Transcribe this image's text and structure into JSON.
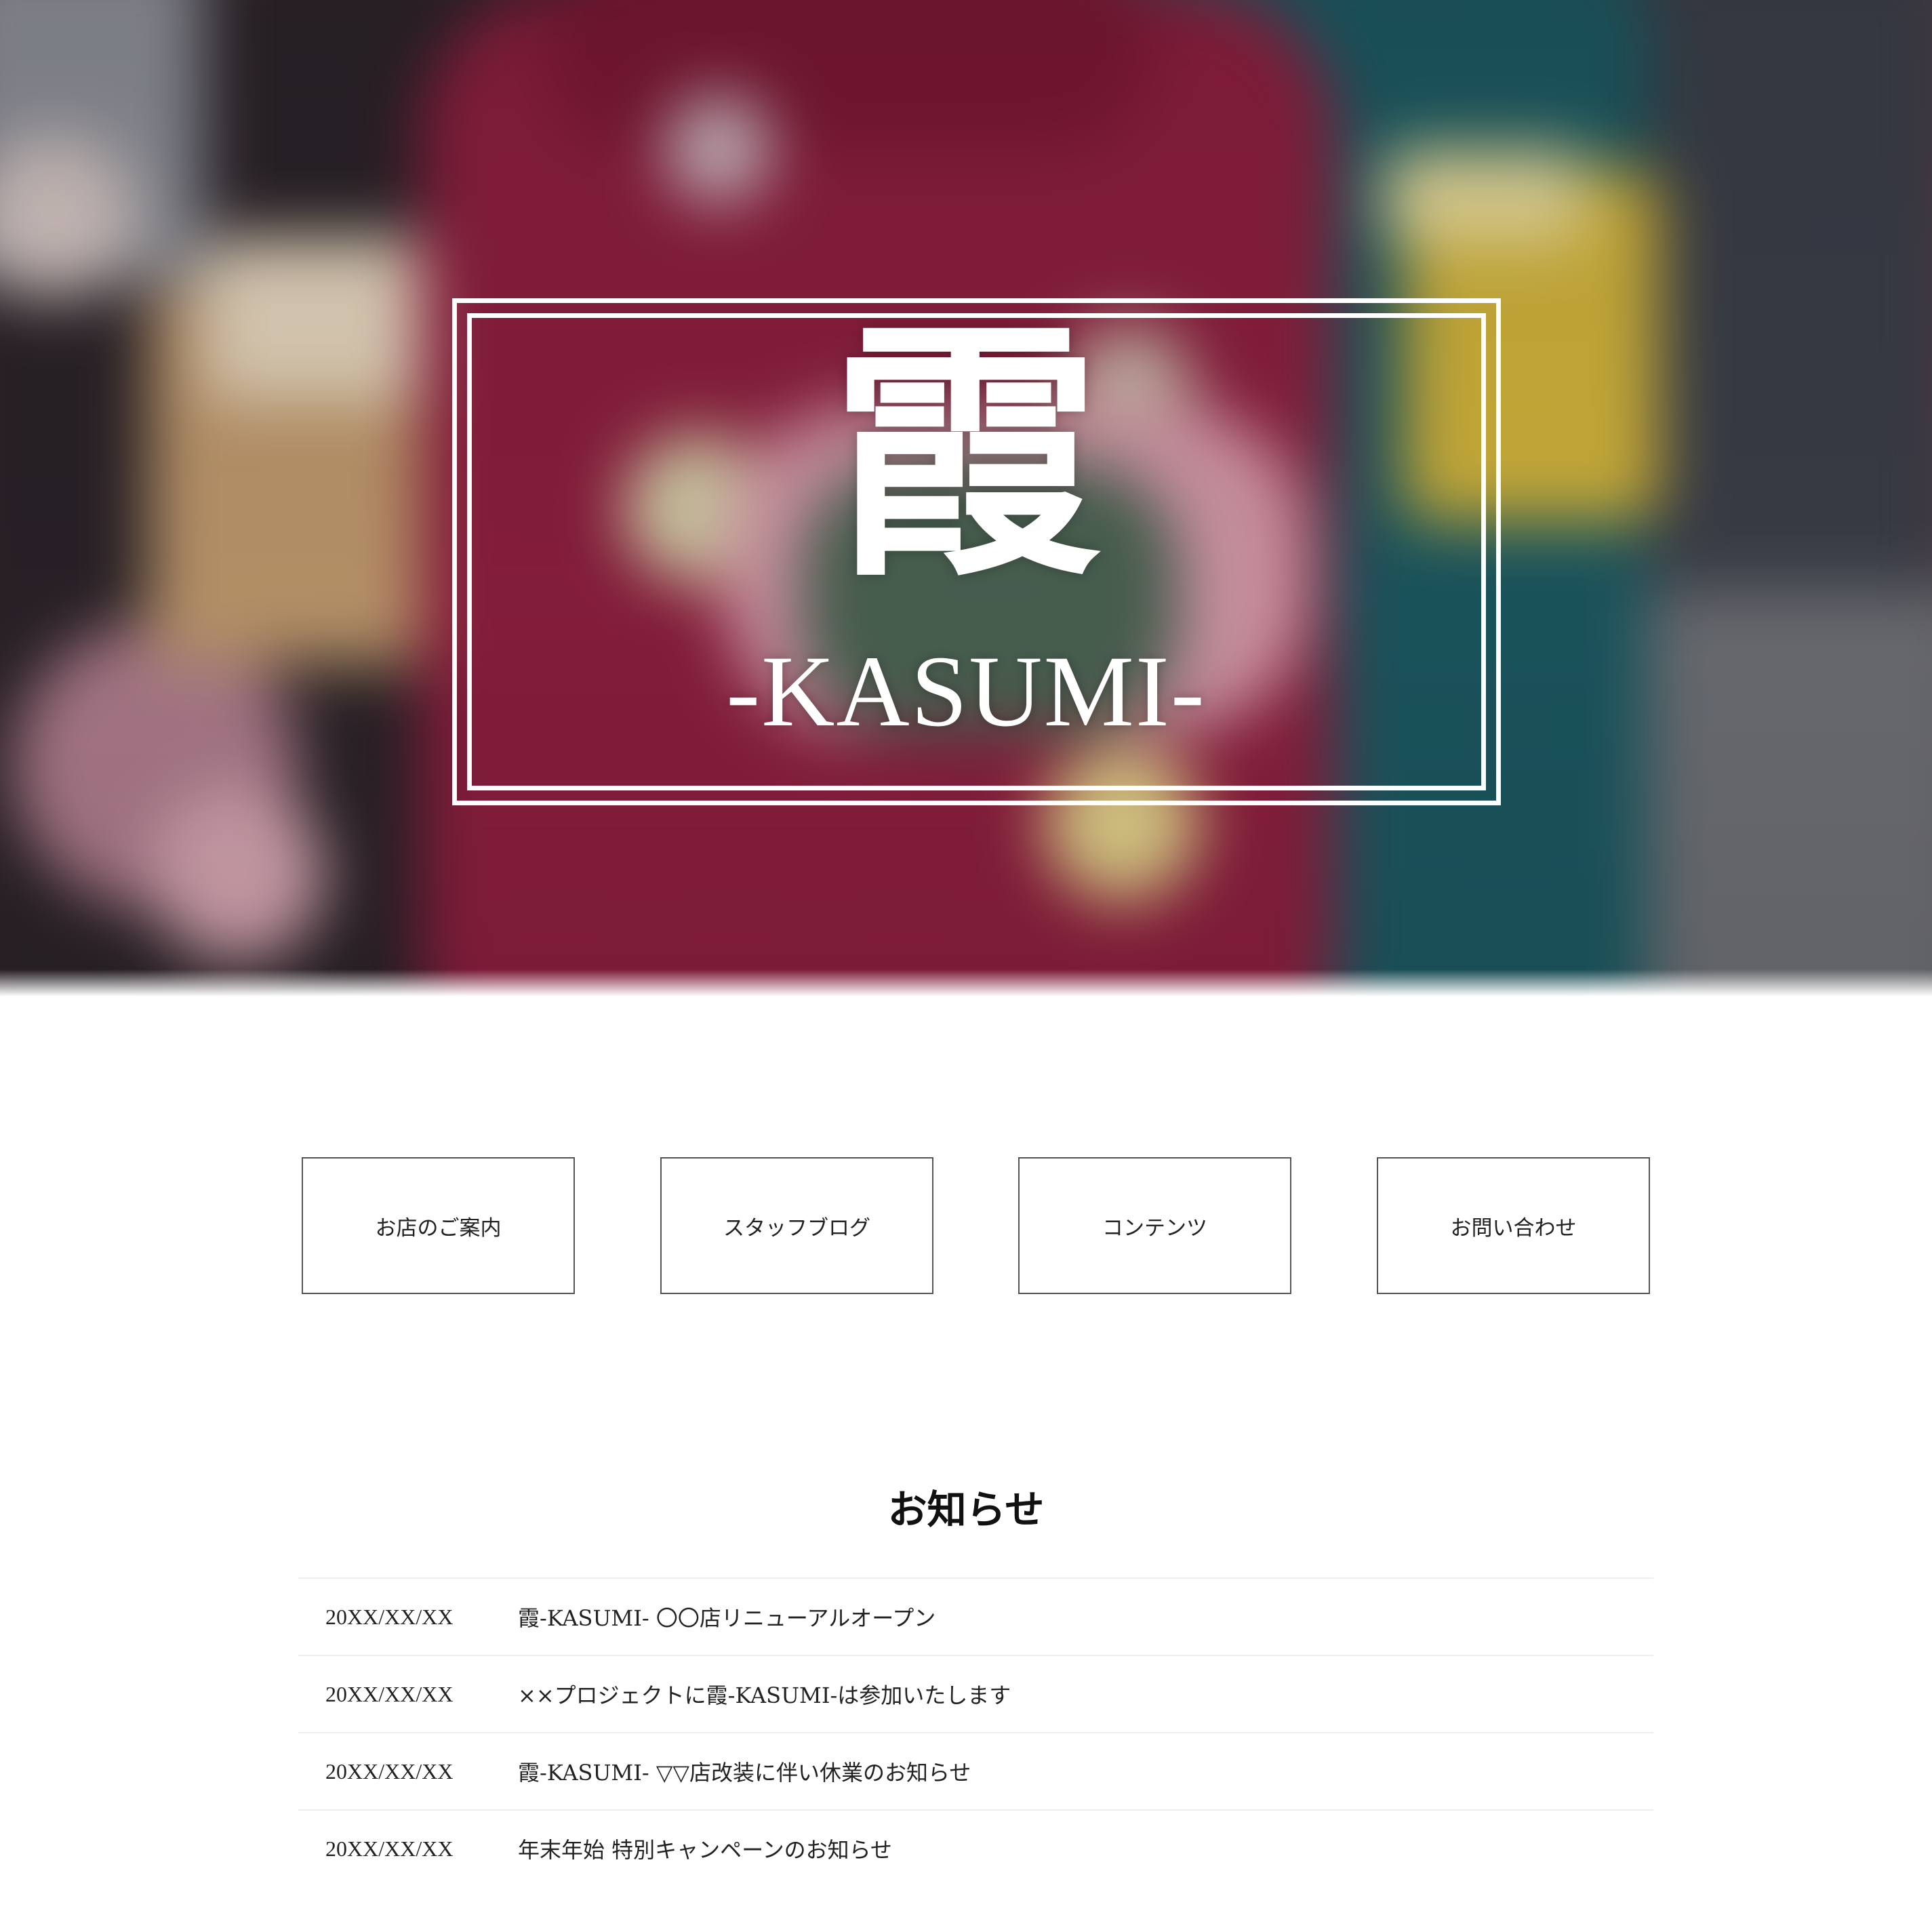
{
  "hero": {
    "logo_kanji": "霞",
    "logo_latin": "-KASUMI-"
  },
  "nav": {
    "items": [
      {
        "label": "お店のご案内"
      },
      {
        "label": "スタッフブログ"
      },
      {
        "label": "コンテンツ"
      },
      {
        "label": "お問い合わせ"
      }
    ]
  },
  "news": {
    "title": "お知らせ",
    "items": [
      {
        "date": "20XX/XX/XX",
        "text": "霞-KASUMI- 〇〇店リニューアルオープン"
      },
      {
        "date": "20XX/XX/XX",
        "text": "××プロジェクトに霞-KASUMI-は参加いたします"
      },
      {
        "date": "20XX/XX/XX",
        "text": "霞-KASUMI- ▽▽店改装に伴い休業のお知らせ"
      },
      {
        "date": "20XX/XX/XX",
        "text": "年末年始 特別キャンペーンのお知らせ"
      }
    ]
  }
}
